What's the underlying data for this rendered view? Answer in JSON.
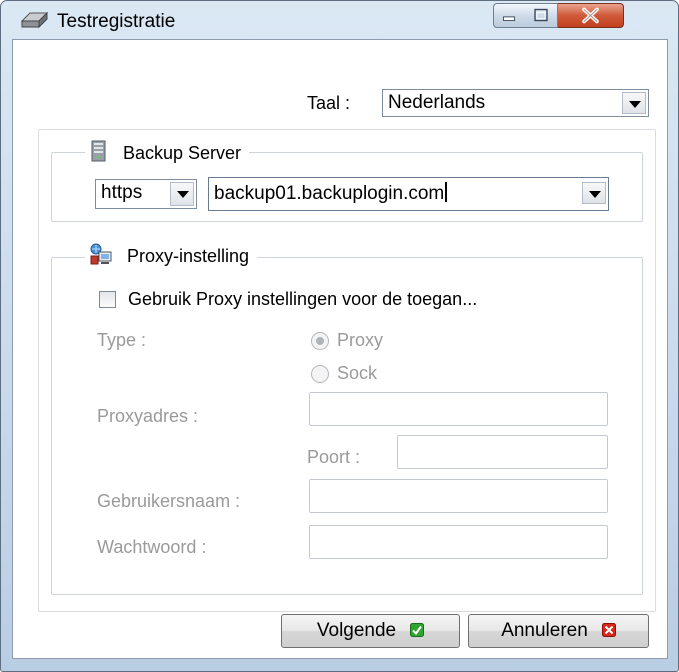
{
  "window": {
    "title": "Testregistratie",
    "icon": "hard-drive-icon"
  },
  "language": {
    "label": "Taal :",
    "value": "Nederlands"
  },
  "backup_server": {
    "legend": "Backup Server",
    "icon": "server-icon",
    "protocol": "https",
    "address": "backup01.backuplogin.com"
  },
  "proxy": {
    "legend": "Proxy-instelling",
    "icon": "proxy-computer-icon",
    "use_proxy_label": "Gebruik Proxy instellingen voor de toegan...",
    "use_proxy_checked": false,
    "type_label": "Type :",
    "type_options": [
      "Proxy",
      "Sock"
    ],
    "type_selected": "Proxy",
    "address_label": "Proxyadres :",
    "address_value": "",
    "port_label": "Poort :",
    "port_value": "",
    "username_label": "Gebruikersnaam :",
    "username_value": "",
    "password_label": "Wachtwoord :",
    "password_value": ""
  },
  "buttons": {
    "next": "Volgende",
    "cancel": "Annuleren"
  },
  "colors": {
    "next_icon": "#2fa52f",
    "cancel_icon": "#d9261c"
  }
}
